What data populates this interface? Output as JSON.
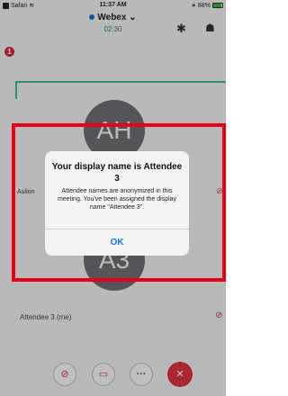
{
  "status_bar": {
    "carrier": "Safari",
    "time": "11:37 AM",
    "battery": "88%",
    "battery_level": 0.88
  },
  "header": {
    "title": "Webex",
    "title_chevron": "⌄",
    "timer": "02:30",
    "bluetooth_icon": "bluetooth-icon",
    "participants_icon": "participants-icon"
  },
  "notification_badge": "1",
  "tiles": {
    "top": {
      "initials": "AH",
      "name": "Aulion"
    },
    "bottom": {
      "initials": "A3"
    }
  },
  "attendee_label": "Attendee 3 (me)",
  "dialog": {
    "title": "Your display name is Attendee 3",
    "message": "Attendee names are anonymized in this meeting. You've been assigned the display name \"Attendee 3\".",
    "ok_label": "OK"
  },
  "controls": {
    "mute_icon": "muted-mic-icon",
    "video_icon": "video-off-icon",
    "more_label": "···",
    "leave_icon": "leave-icon"
  },
  "colors": {
    "accent": "#1a73e8",
    "leave": "#d9323e",
    "highlight": "#e2001a",
    "active_speaker": "#3fb89d"
  }
}
